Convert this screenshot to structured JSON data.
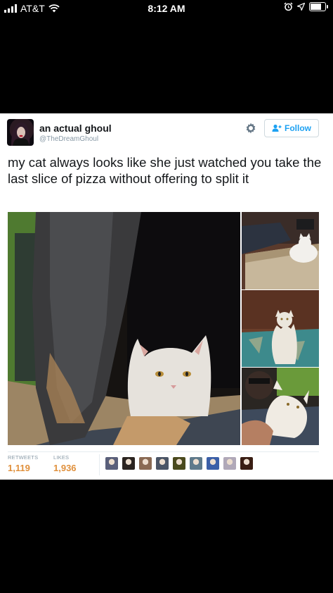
{
  "status_bar": {
    "carrier": "AT&T",
    "time": "8:12 AM",
    "battery_level": 0.85
  },
  "tweet": {
    "author_name": "an actual ghoul",
    "author_handle": "@TheDreamGhoul",
    "follow_label": "Follow",
    "text": "my cat always looks like she just watched you take the last slice of pizza without offering to split it",
    "stats": {
      "retweets_label": "RETWEETS",
      "retweets_value": "1,119",
      "likes_label": "LIKES",
      "likes_value": "1,936"
    },
    "liker_colors": [
      "#5a5f7a",
      "#2b2420",
      "#8a6a54",
      "#4b5566",
      "#4a4a1e",
      "#5f7a8c",
      "#3b5fa8",
      "#b0a8b8",
      "#3a1e14"
    ]
  },
  "colors": {
    "accent": "#1da1f2",
    "stat_value": "#e0903c"
  },
  "icons": [
    "signal-icon",
    "wifi-icon",
    "alarm-icon",
    "location-icon",
    "battery-icon",
    "gear-icon",
    "add-user-icon"
  ]
}
